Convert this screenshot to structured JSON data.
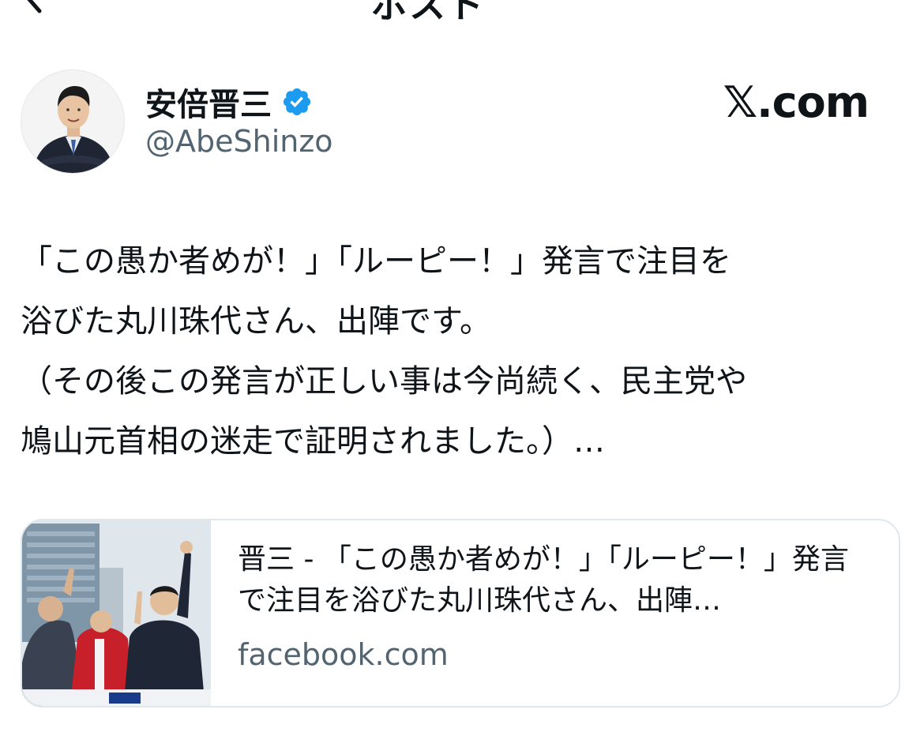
{
  "header": {
    "title_fragment": "ポスト"
  },
  "tweet": {
    "author": {
      "display_name": "安倍晋三",
      "handle": "@AbeShinzo",
      "verified": true
    },
    "source_label": "𝕏.com",
    "text": "「この愚か者めが！」「ルーピー！」発言で注目を\n浴びた丸川珠代さん、出陣です。\n（その後この発言が正しい事は今尚続く、民主党や\n鳩山元首相の迷走で証明されました。）…",
    "link_card": {
      "title": "晋三 - 「この愚か者めが！」「ルーピー！」発言で注目を浴びた丸川珠代さん、出陣…",
      "domain": "facebook.com"
    }
  },
  "colors": {
    "text": "#0f1419",
    "secondary": "#536471",
    "verified": "#1d9bf0",
    "card_border": "#e1e8ed"
  },
  "icons": {
    "back": "chevron-left-icon",
    "verified": "verified-badge-icon"
  }
}
